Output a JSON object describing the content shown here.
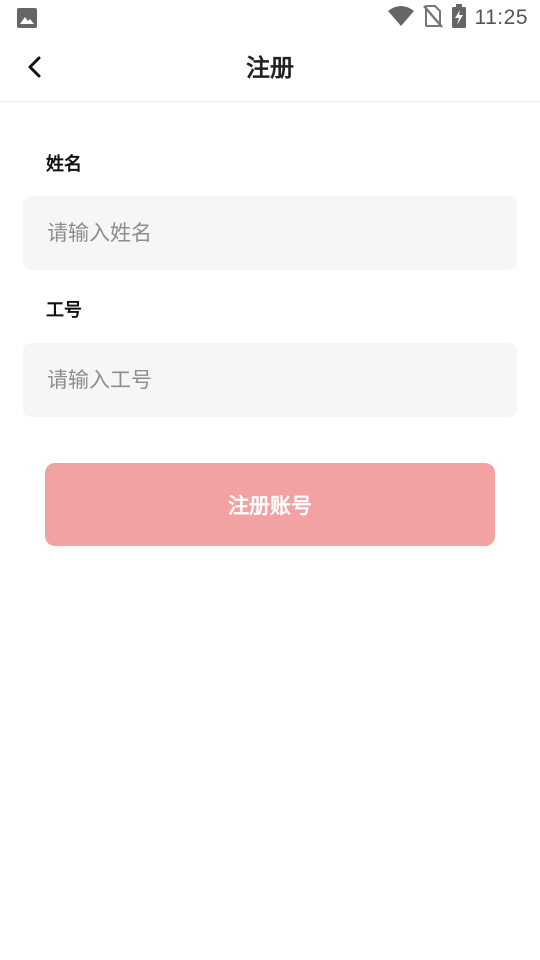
{
  "status_bar": {
    "time": "11:25",
    "icons": [
      "image-icon",
      "wifi-icon",
      "no-sim-icon",
      "battery-charging-icon"
    ]
  },
  "nav": {
    "back_icon": "chevron-left-icon",
    "title": "注册"
  },
  "form": {
    "name": {
      "label": "姓名",
      "value": "",
      "placeholder": "请输入姓名"
    },
    "employee_id": {
      "label": "工号",
      "value": "",
      "placeholder": "请输入工号"
    },
    "submit_label": "注册账号"
  },
  "colors": {
    "submit_button_bg": "#f2a2a3",
    "input_bg": "#f6f6f6",
    "status_icon": "#666666"
  }
}
